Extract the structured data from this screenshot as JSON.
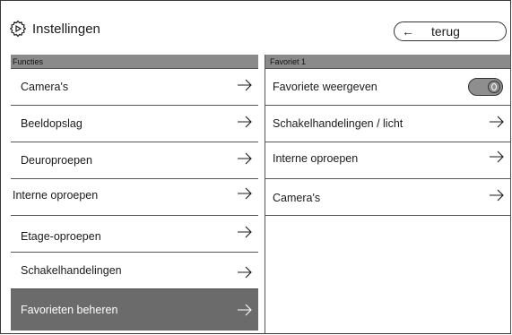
{
  "header": {
    "title": "Instellingen",
    "back_label": "terug",
    "back_arrow": "←"
  },
  "left_panel": {
    "heading": "Functies",
    "items": [
      {
        "label": "Camera's"
      },
      {
        "label": "Beeldopslag"
      },
      {
        "label": "Deuroproepen"
      },
      {
        "label": "Interne oproepen"
      },
      {
        "label": "Etage-oproepen"
      },
      {
        "label": "Schakelhandelingen"
      },
      {
        "label": "Favorieten beheren",
        "active": true
      }
    ]
  },
  "right_panel": {
    "heading": "Favoriet 1",
    "toggle_row": {
      "label": "Favoriete weergeven",
      "state": "off"
    },
    "items": [
      {
        "label": "Schakelhandelingen / licht"
      },
      {
        "label": "Interne oproepen"
      },
      {
        "label": "Camera's"
      }
    ]
  },
  "colors": {
    "header_bar": "#8a8a8a",
    "active_row": "#6b6b6b",
    "border": "#555555"
  }
}
